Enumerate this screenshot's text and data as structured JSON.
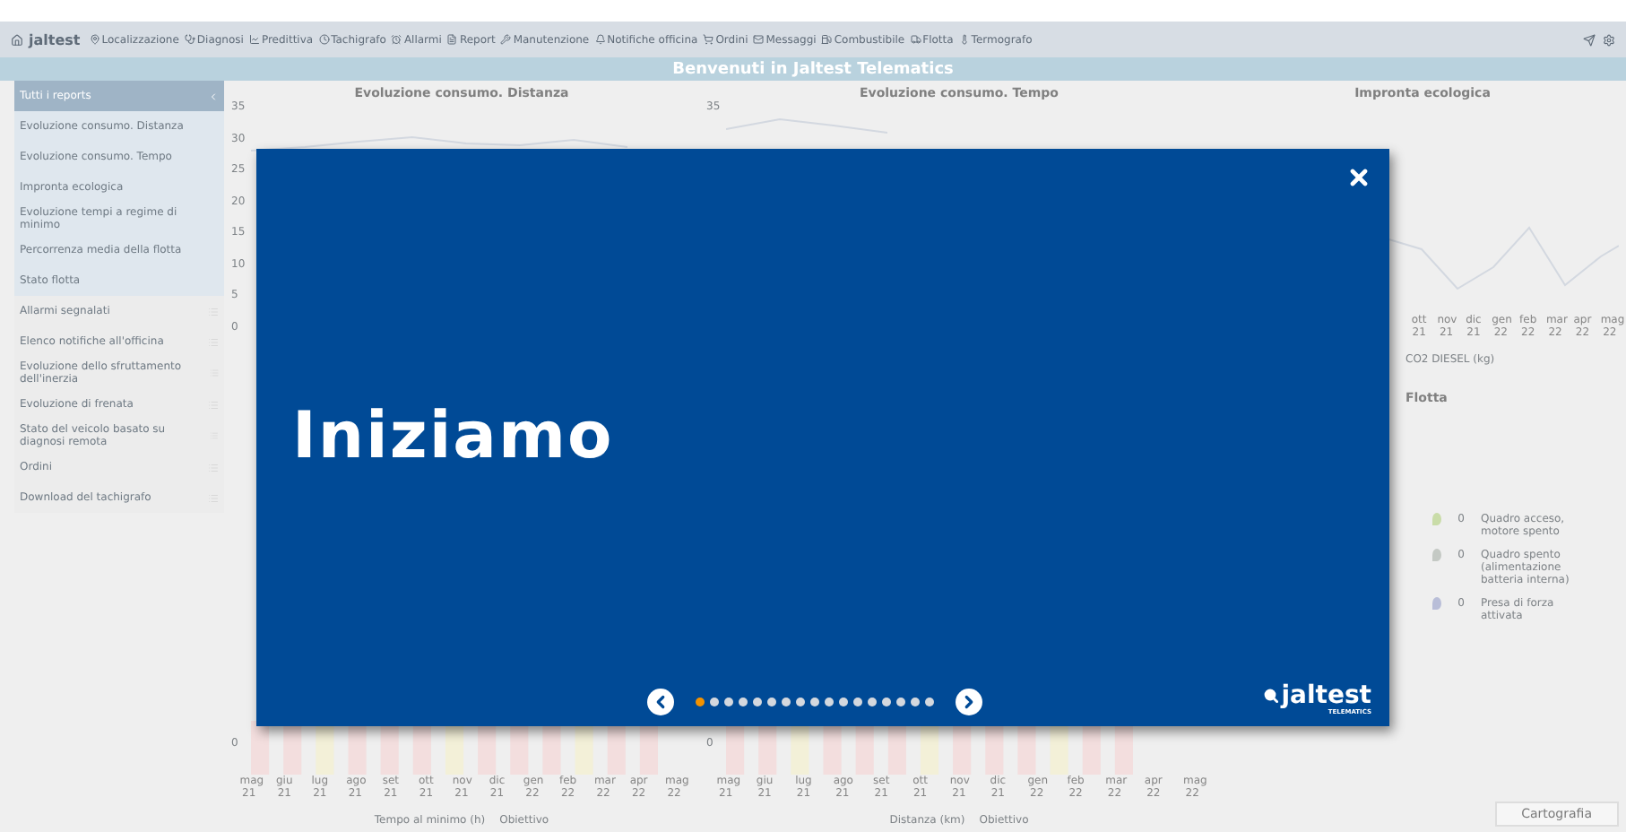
{
  "nav": {
    "logo": "jaltest",
    "items": [
      "Localizzazione",
      "Diagnosi",
      "Predittiva",
      "Tachigrafo",
      "Allarmi",
      "Report",
      "Manutenzione",
      "Notifiche officina",
      "Ordini",
      "Messaggi",
      "Combustibile",
      "Flotta",
      "Termografo"
    ]
  },
  "title_bar": {
    "title": "Benvenuti in Jaltest Telematics"
  },
  "sidebar": {
    "header": "Tutti i reports",
    "items": [
      {
        "label": "Evoluzione consumo. Distanza",
        "group": true
      },
      {
        "label": "Evoluzione consumo. Tempo",
        "group": true
      },
      {
        "label": "Impronta ecologica",
        "group": true
      },
      {
        "label": "Evoluzione tempi a regime di minimo",
        "group": true
      },
      {
        "label": "Percorrenza media della flotta",
        "group": true
      },
      {
        "label": "Stato flotta",
        "group": true
      },
      {
        "label": "Allarmi segnalati",
        "group": false
      },
      {
        "label": "Elenco notifiche all'officina",
        "group": false
      },
      {
        "label": "Evoluzione dello sfruttamento dell'inerzia",
        "group": false
      },
      {
        "label": "Evoluzione di frenata",
        "group": false
      },
      {
        "label": "Stato del veicolo basato su diagnosi remota",
        "group": false
      },
      {
        "label": "Ordini",
        "group": false
      },
      {
        "label": "Download del tachigrafo",
        "group": false
      }
    ]
  },
  "charts": [
    {
      "title": "Evoluzione consumo. Distanza",
      "y_labels": [
        "35",
        "30",
        "25",
        "20",
        "15",
        "10",
        "5",
        "0"
      ]
    },
    {
      "title": "Evoluzione consumo. Tempo",
      "y_labels": [
        "35"
      ]
    },
    {
      "title": "Impronta ecologica",
      "x_labels": [
        "ott 21",
        "nov 21",
        "dic 21",
        "gen 22",
        "feb 22",
        "mar 22",
        "apr 22",
        "mag 22"
      ],
      "legend": "CO2 DIESEL (kg)"
    }
  ],
  "fleet": {
    "title": "Flotta",
    "legend": [
      {
        "count": "0",
        "label": "Quadro acceso, motore spento",
        "color": "#c9dca8"
      },
      {
        "count": "0",
        "label": "Quadro spento (alimentazione batteria interna)",
        "color": "#c4c9c4"
      },
      {
        "count": "0",
        "label": "Presa di forza attivata",
        "color": "#b9bed8"
      }
    ]
  },
  "bar_charts": [
    {
      "zero": "0",
      "x_labels": [
        "mag 21",
        "giu 21",
        "lug 21",
        "ago 21",
        "set 21",
        "ott 21",
        "nov 21",
        "dic 21",
        "gen 22",
        "feb 22",
        "mar 22",
        "apr 22",
        "mag 22"
      ],
      "legend": [
        "Tempo al minimo (h)",
        "Obiettivo"
      ]
    },
    {
      "zero": "0",
      "x_labels": [
        "mag 21",
        "giu 21",
        "lug 21",
        "ago 21",
        "set 21",
        "ott 21",
        "nov 21",
        "dic 21",
        "gen 22",
        "feb 22",
        "mar 22",
        "apr 22",
        "mag 22"
      ],
      "legend": [
        "Distanza (km)",
        "Obiettivo"
      ]
    }
  ],
  "footer_button": "Cartografia",
  "modal": {
    "heading": "Iniziamo",
    "dots": [
      {
        "selected": true
      },
      {
        "selected": false
      },
      {
        "selected": false
      },
      {
        "selected": false
      },
      {
        "selected": false
      },
      {
        "selected": false
      },
      {
        "selected": false
      },
      {
        "selected": false
      },
      {
        "selected": false
      },
      {
        "selected": false
      },
      {
        "selected": false
      },
      {
        "selected": false
      },
      {
        "selected": false
      },
      {
        "selected": false
      },
      {
        "selected": false
      },
      {
        "selected": false
      },
      {
        "selected": false
      }
    ],
    "logo": {
      "name": "jaltest",
      "tagline": "TELEMATICS"
    }
  }
}
